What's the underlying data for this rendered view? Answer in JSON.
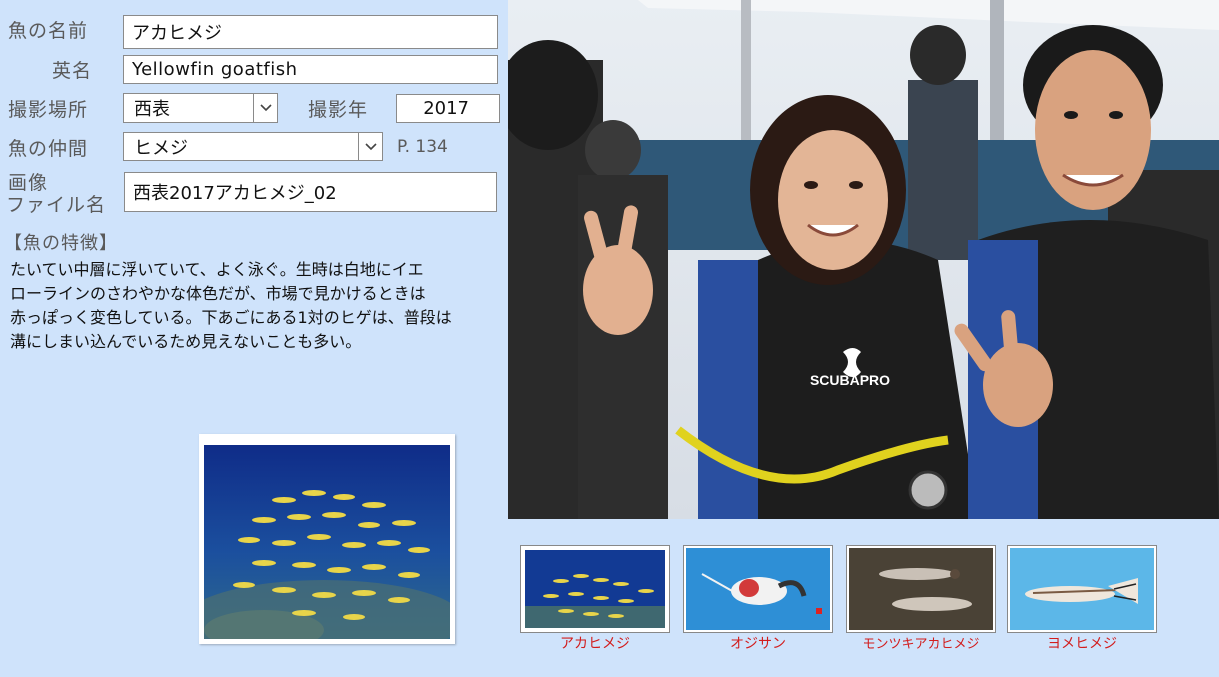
{
  "form": {
    "fish_name_label": "魚の名前",
    "fish_name_value": "アカヒメジ",
    "english_name_label": "英名",
    "english_name_value": "Yellowfin goatfish",
    "location_label": "撮影場所",
    "location_value": "西表",
    "year_label": "撮影年",
    "year_value": "2017",
    "family_label": "魚の仲間",
    "family_value": "ヒメジ",
    "page_ref": "P. 134",
    "image_label_line1": "画像",
    "image_label_line2": "ファイル名",
    "image_file_value": "西表2017アカヒメジ_02"
  },
  "features": {
    "heading": "【魚の特徴】",
    "lines": [
      "たいてい中層に浮いていて、よく泳ぐ。生時は白地にイエ",
      "ローラインのさわやかな体色だが、市場で見かけるときは",
      "赤っぽっく変色している。下あごにある1対のヒゲは、普段は",
      "溝にしまい込んでいるため見えないことも多い。"
    ]
  },
  "photo_text": {
    "wetsuit_brand": "SCUBAPRO"
  },
  "thumbnails": [
    {
      "label": "アカヒメジ"
    },
    {
      "label": "オジサン"
    },
    {
      "label": "モンツキアカヒメジ"
    },
    {
      "label": "ヨメヒメジ"
    }
  ],
  "colors": {
    "background": "#cfe3fb",
    "thumb_label": "#d21c1c"
  }
}
